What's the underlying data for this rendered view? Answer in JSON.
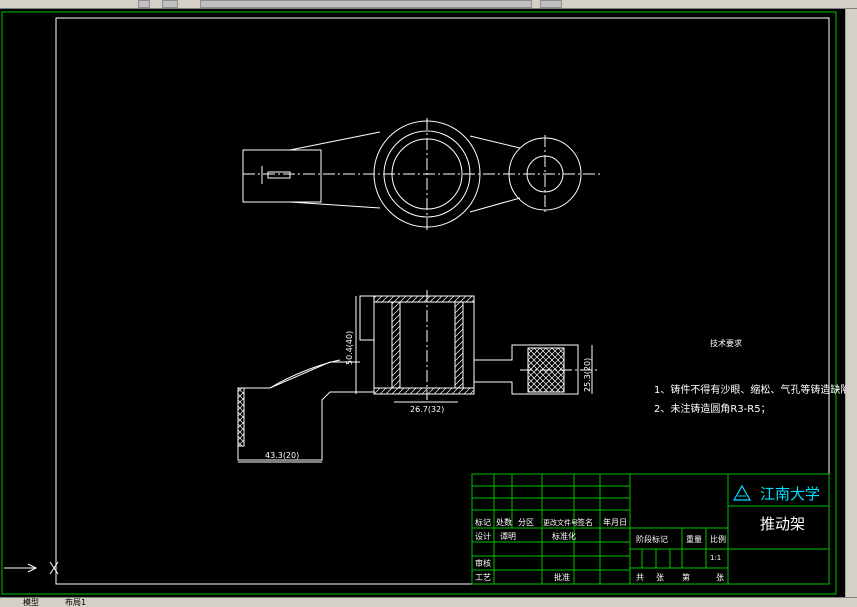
{
  "tech_requirements": {
    "title": "技术要求",
    "items": [
      "1、铸件不得有沙眼、缩松、气孔等铸造缺陷；",
      "2、未注铸造圆角R3-R5；"
    ]
  },
  "dimensions": {
    "height_left": "50.4(40)",
    "width_bore": "26.7(32)",
    "height_right": "25.3(20)",
    "width_bottom": "43.3(20)"
  },
  "title_block": {
    "school": "江南大学",
    "part_name": "推动架",
    "scale": "1:1",
    "row_labels": [
      "标记",
      "处数",
      "分区",
      "更改文件号",
      "签名",
      "年月日"
    ],
    "design": "设计",
    "design_name": "谭明",
    "standardize": "标准化",
    "check": "审核",
    "process": "工艺",
    "approve": "批准",
    "stage_mark": "阶段标记",
    "weight": "重量",
    "ratio": "比例",
    "total": "共",
    "sheets": "张",
    "page": "第",
    "sheet_unit": "张"
  },
  "status_tabs": [
    "模型",
    "布局1"
  ],
  "colors": {
    "background": "#000000",
    "lines": "#ffffff",
    "border_green": "#00c000",
    "school_cyan": "#00e0ff"
  }
}
